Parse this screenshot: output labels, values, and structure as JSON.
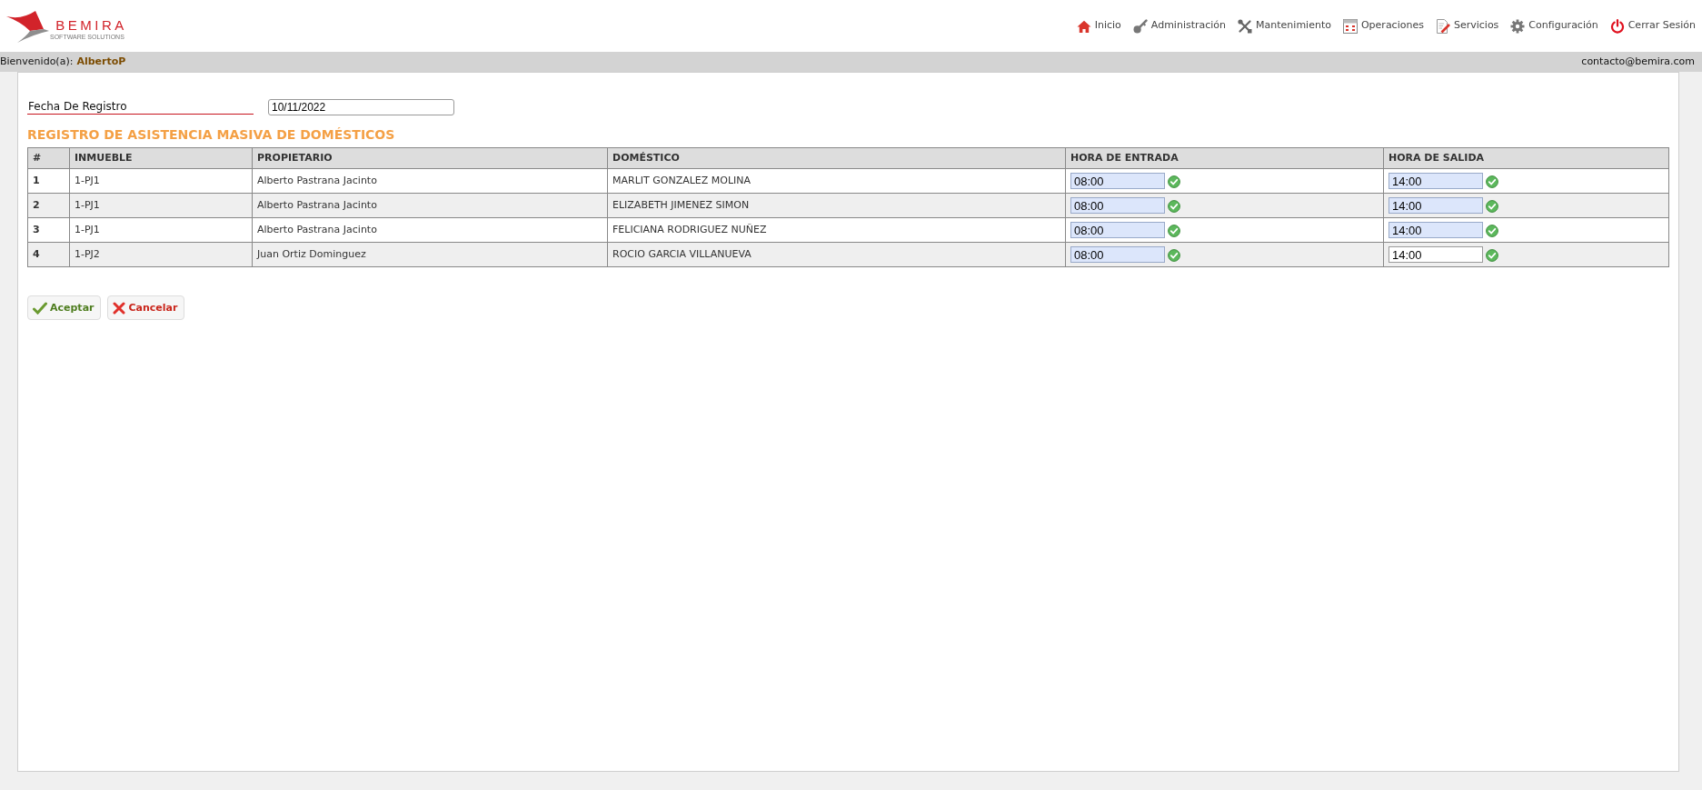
{
  "logo": {
    "name": "BEMIRA",
    "tagline": "SOFTWARE SOLUTIONS"
  },
  "nav": [
    {
      "label": "Inicio",
      "kind": "home"
    },
    {
      "label": "Administración",
      "kind": "key"
    },
    {
      "label": "Mantenimiento",
      "kind": "tools"
    },
    {
      "label": "Operaciones",
      "kind": "calendar"
    },
    {
      "label": "Servicios",
      "kind": "document"
    },
    {
      "label": "Configuración",
      "kind": "gear"
    },
    {
      "label": "Cerrar Sesión",
      "kind": "power"
    }
  ],
  "user_bar": {
    "greeting": "Bienvenido(a):",
    "user": "AlbertoP",
    "email": "contacto@bemira.com"
  },
  "form": {
    "date_label": "Fecha De Registro",
    "date_value": "10/11/2022"
  },
  "title": "REGISTRO DE ASISTENCIA MASIVA DE DOMÉSTICOS",
  "table": {
    "columns": [
      "#",
      "INMUEBLE",
      "PROPIETARIO",
      "DOMÉSTICO",
      "HORA DE ENTRADA",
      "HORA DE SALIDA"
    ],
    "rows": [
      {
        "number": "1",
        "property": "1-PJ1",
        "owner": "Alberto Pastrana Jacinto",
        "domestic": "MARLIT GONZALEZ MOLINA",
        "entry": {
          "value": "08:00",
          "highlighted": true,
          "valid": true
        },
        "exit": {
          "value": "14:00",
          "highlighted": true,
          "valid": true
        }
      },
      {
        "number": "2",
        "property": "1-PJ1",
        "owner": "Alberto Pastrana Jacinto",
        "domestic": "ELIZABETH JIMENEZ SIMON",
        "entry": {
          "value": "08:00",
          "highlighted": true,
          "valid": true
        },
        "exit": {
          "value": "14:00",
          "highlighted": true,
          "valid": true
        }
      },
      {
        "number": "3",
        "property": "1-PJ1",
        "owner": "Alberto Pastrana Jacinto",
        "domestic": "FELICIANA RODRIGUEZ NUÑEZ",
        "entry": {
          "value": "08:00",
          "highlighted": true,
          "valid": true
        },
        "exit": {
          "value": "14:00",
          "highlighted": true,
          "valid": true
        }
      },
      {
        "number": "4",
        "property": "1-PJ2",
        "owner": "Juan Ortiz Dominguez",
        "domestic": "ROCIO GARCIA VILLANUEVA",
        "entry": {
          "value": "08:00",
          "highlighted": true,
          "valid": true
        },
        "exit": {
          "value": "14:00",
          "highlighted": false,
          "valid": true
        }
      }
    ]
  },
  "buttons": [
    {
      "label": "Aceptar",
      "kind": "accept"
    },
    {
      "label": "Cancelar",
      "kind": "cancel"
    }
  ]
}
